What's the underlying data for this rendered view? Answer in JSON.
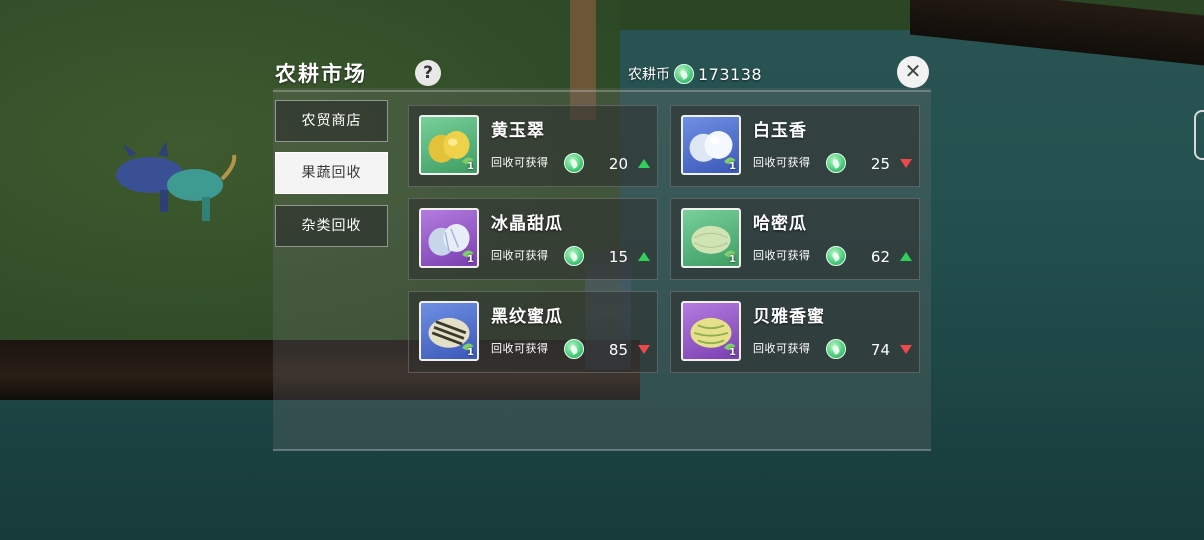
{
  "panel": {
    "title": "农耕市场",
    "currency_label": "农耕币",
    "currency_amount": "173138",
    "help_icon": "question-icon",
    "close_icon": "close-x-icon"
  },
  "tabs": [
    {
      "label": "农贸商店",
      "active": false
    },
    {
      "label": "果蔬回收",
      "active": true
    },
    {
      "label": "杂类回收",
      "active": false
    }
  ],
  "reward_label": "回收可获得",
  "items": [
    {
      "name": "黄玉翠",
      "qty": "1",
      "price": "20",
      "trend": "up",
      "icon_bg": "green",
      "fruit": "yellow-melon"
    },
    {
      "name": "白玉香",
      "qty": "1",
      "price": "25",
      "trend": "down",
      "icon_bg": "blue",
      "fruit": "white-melon"
    },
    {
      "name": "冰晶甜瓜",
      "qty": "1",
      "price": "15",
      "trend": "up",
      "icon_bg": "purple",
      "fruit": "ice-melon"
    },
    {
      "name": "哈密瓜",
      "qty": "1",
      "price": "62",
      "trend": "up",
      "icon_bg": "green",
      "fruit": "hami-melon"
    },
    {
      "name": "黑纹蜜瓜",
      "qty": "1",
      "price": "85",
      "trend": "down",
      "icon_bg": "blue",
      "fruit": "striped-melon"
    },
    {
      "name": "贝雅香蜜",
      "qty": "1",
      "price": "74",
      "trend": "down",
      "icon_bg": "purple",
      "fruit": "beiya-melon"
    }
  ],
  "colors": {
    "trend_up": "#2fd15a",
    "trend_down": "#f04848",
    "coin": "#4fcf7e"
  }
}
